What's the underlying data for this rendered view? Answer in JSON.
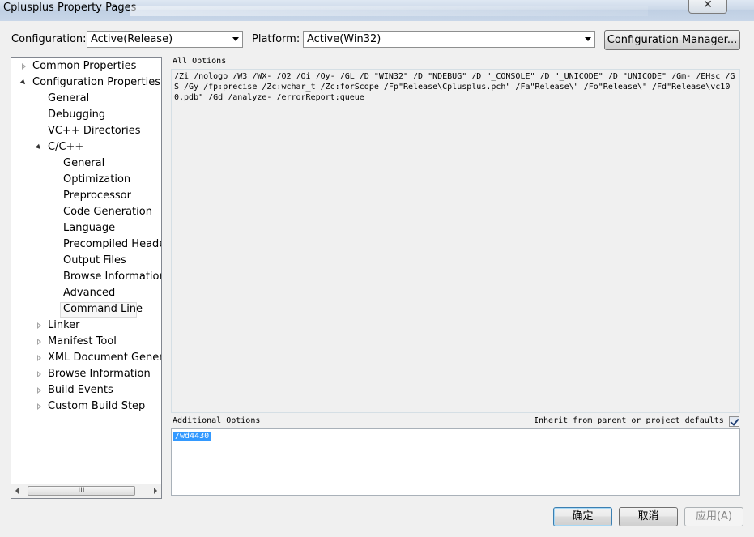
{
  "window": {
    "title": "Cplusplus Property Pages",
    "close_glyph": "✕"
  },
  "config": {
    "label": "Configuration:",
    "value": "Active(Release)"
  },
  "platform": {
    "label": "Platform:",
    "value": "Active(Win32)"
  },
  "config_manager_label": "Configuration Manager...",
  "tree": {
    "nodes": [
      {
        "label": "Common Properties",
        "state": "collapsed"
      },
      {
        "label": "Configuration Properties",
        "state": "expanded"
      },
      {
        "label": "General"
      },
      {
        "label": "Debugging"
      },
      {
        "label": "VC++ Directories"
      },
      {
        "label": "C/C++",
        "state": "expanded"
      },
      {
        "label": "General"
      },
      {
        "label": "Optimization"
      },
      {
        "label": "Preprocessor"
      },
      {
        "label": "Code Generation"
      },
      {
        "label": "Language"
      },
      {
        "label": "Precompiled Headers"
      },
      {
        "label": "Output Files"
      },
      {
        "label": "Browse Information"
      },
      {
        "label": "Advanced"
      },
      {
        "label": "Command Line",
        "selected": true
      },
      {
        "label": "Linker",
        "state": "collapsed"
      },
      {
        "label": "Manifest Tool",
        "state": "collapsed"
      },
      {
        "label": "XML Document Generator",
        "state": "collapsed"
      },
      {
        "label": "Browse Information",
        "state": "collapsed"
      },
      {
        "label": "Build Events",
        "state": "collapsed"
      },
      {
        "label": "Custom Build Step",
        "state": "collapsed"
      }
    ],
    "scroll_thumb_glyph": "III"
  },
  "all_options": {
    "label": "All Options",
    "text": "/Zi /nologo /W3 /WX- /O2 /Oi /Oy- /GL /D \"WIN32\" /D \"NDEBUG\" /D \"_CONSOLE\" /D \"_UNICODE\" /D \"UNICODE\" /Gm- /EHsc /GS /Gy /fp:precise /Zc:wchar_t /Zc:forScope /Fp\"Release\\Cplusplus.pch\" /Fa\"Release\\\" /Fo\"Release\\\" /Fd\"Release\\vc100.pdb\" /Gd /analyze- /errorReport:queue"
  },
  "additional_options": {
    "label": "Additional Options",
    "value": "/wd4430",
    "inherit_label": "Inherit from parent or project defaults",
    "inherit_checked": true
  },
  "buttons": {
    "ok": "确定",
    "cancel": "取消",
    "apply": "应用(A)"
  }
}
